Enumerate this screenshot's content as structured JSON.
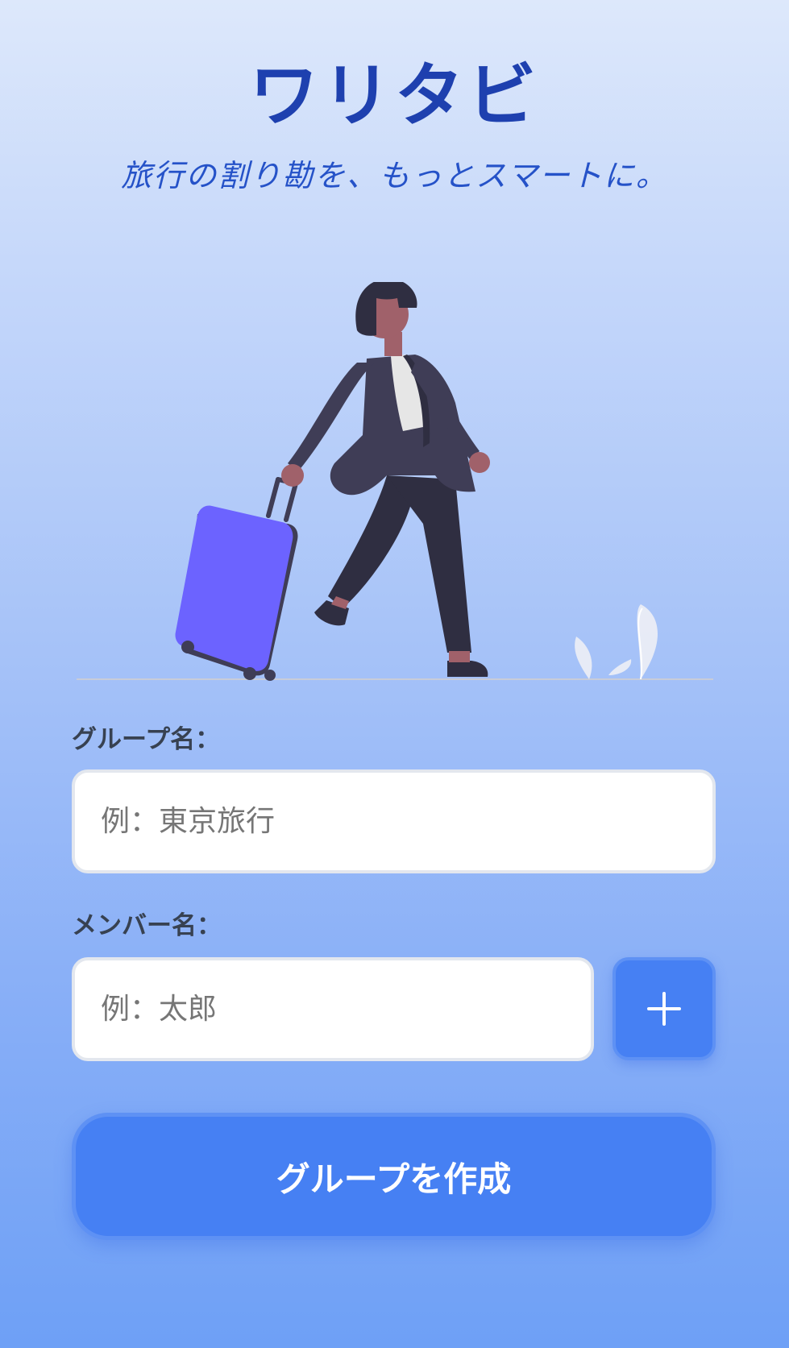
{
  "app": {
    "title": "ワリタビ",
    "tagline": "旅行の割り勘を、もっとスマートに。"
  },
  "illustration": {
    "description_icon": "traveler-with-suitcase-icon"
  },
  "form": {
    "group_name_label": "グループ名：",
    "group_name_placeholder": "例：東京旅行",
    "group_name_value": "",
    "member_name_label": "メンバー名：",
    "member_name_placeholder": "例：太郎",
    "member_name_value": "",
    "add_member_icon": "plus-icon",
    "create_button_label": "グループを作成"
  },
  "colors": {
    "title": "#1e40af",
    "accent": "#4680f3",
    "background_top": "#dde8fb",
    "background_bottom": "#6ea0f6",
    "suitcase": "#6c63ff"
  }
}
